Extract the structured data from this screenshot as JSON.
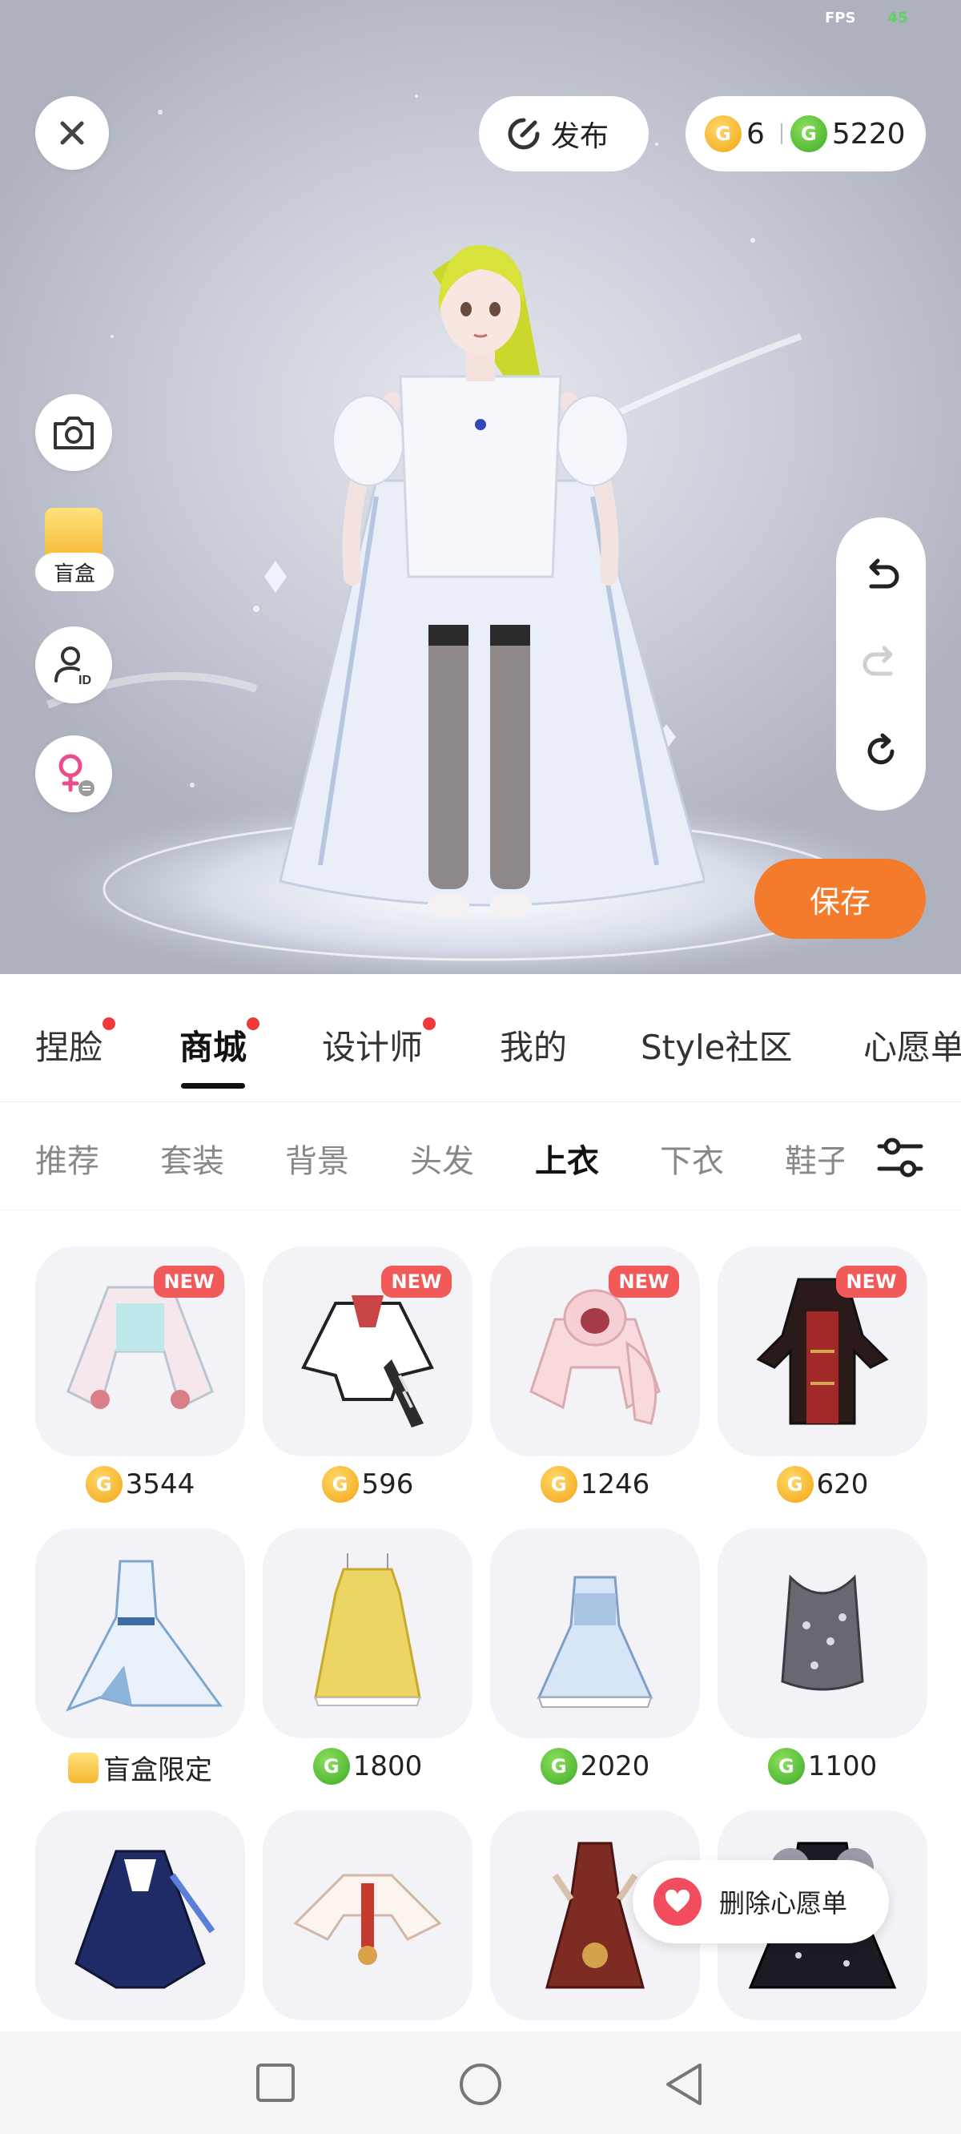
{
  "fps": {
    "label": "FPS",
    "value": "45"
  },
  "top": {
    "publish_label": "发布",
    "gold_coins": "6",
    "green_coins": "5220"
  },
  "side": {
    "blindbox_label": "盲盒"
  },
  "save_label": "保存",
  "main_tabs": [
    {
      "label": "捏脸",
      "dot": true
    },
    {
      "label": "商城",
      "dot": true,
      "active": true
    },
    {
      "label": "设计师",
      "dot": true
    },
    {
      "label": "我的",
      "dot": false
    },
    {
      "label": "Style社区",
      "dot": false
    },
    {
      "label": "心愿单",
      "dot": false
    }
  ],
  "sub_tabs": [
    {
      "label": "推荐"
    },
    {
      "label": "套装"
    },
    {
      "label": "背景"
    },
    {
      "label": "头发"
    },
    {
      "label": "上衣",
      "active": true
    },
    {
      "label": "下衣"
    },
    {
      "label": "鞋子"
    }
  ],
  "items": [
    {
      "name": "white-pink-jacket",
      "price": "3544",
      "currency": "gold",
      "new": true,
      "new_label": "NEW"
    },
    {
      "name": "scarf-jacket",
      "price": "596",
      "currency": "gold",
      "new": true,
      "new_label": "NEW"
    },
    {
      "name": "pink-hoodie",
      "price": "1246",
      "currency": "gold",
      "new": true,
      "new_label": "NEW"
    },
    {
      "name": "black-red-robe",
      "price": "620",
      "currency": "gold",
      "new": true,
      "new_label": "NEW"
    },
    {
      "name": "ice-dress",
      "price": "盲盒限定",
      "currency": "blindbox",
      "new": false
    },
    {
      "name": "yellow-dress",
      "price": "1800",
      "currency": "green",
      "new": false
    },
    {
      "name": "blue-dress",
      "price": "2020",
      "currency": "green",
      "new": false
    },
    {
      "name": "sequin-top",
      "price": "1100",
      "currency": "green",
      "new": false
    },
    {
      "name": "navy-dress",
      "price": "",
      "currency": "",
      "new": false
    },
    {
      "name": "white-red-blouse",
      "price": "",
      "currency": "",
      "new": false
    },
    {
      "name": "red-qipao",
      "price": "",
      "currency": "",
      "new": false
    },
    {
      "name": "black-gown",
      "price": "",
      "currency": "",
      "new": false
    }
  ],
  "wishlist_label": "删除心愿单"
}
